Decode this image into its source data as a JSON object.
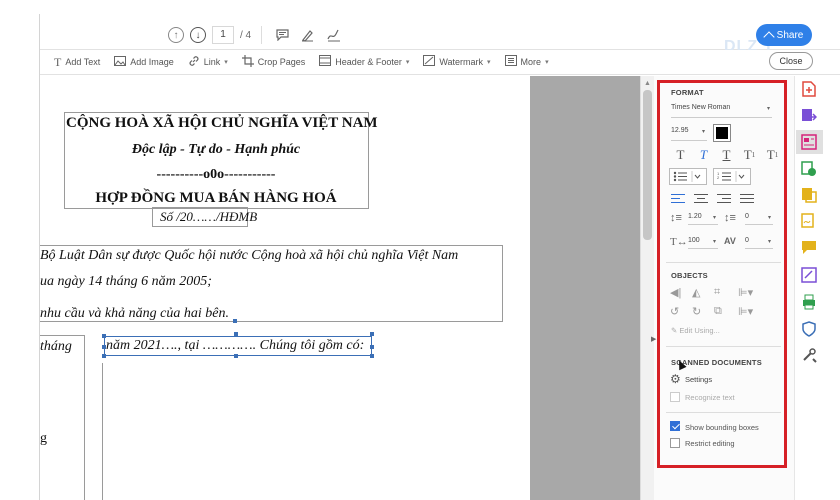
{
  "nav": {
    "page_current": "1",
    "page_total": "/ 4",
    "share_label": "Share"
  },
  "edit_toolbar": {
    "tools": [
      {
        "label": "Add Text",
        "icon": "text-icon"
      },
      {
        "label": "Add Image",
        "icon": "image-icon"
      },
      {
        "label": "Link",
        "icon": "link-icon",
        "dropdown": true
      },
      {
        "label": "Crop Pages",
        "icon": "crop-icon"
      },
      {
        "label": "Header & Footer",
        "icon": "header-footer-icon",
        "dropdown": true
      },
      {
        "label": "Watermark",
        "icon": "watermark-icon",
        "dropdown": true
      },
      {
        "label": "More",
        "icon": "more-icon",
        "dropdown": true
      }
    ],
    "close_label": "Close"
  },
  "watermark_logo": "DLZ T",
  "document": {
    "nation": "CỘNG HOÀ XÃ HỘI CHỦ NGHĨA VIỆT NAM",
    "motto": "Độc lập - Tự do - Hạnh phúc",
    "separator": "----------o0o-----------",
    "title": "HỢP ĐỒNG MUA BÁN HÀNG HOÁ",
    "number": "Số      /20……/HĐMB",
    "para_line1": "Bộ Luật Dân sự được Quốc hội nước Cộng hoà xã hội chủ nghĩa Việt Nam",
    "para_line2": "ua ngày 14 tháng 6 năm 2005;",
    "para_line3": "nhu cầu và khả năng của hai bên.",
    "cell_left": "tháng",
    "cell_year": "năm 2021…., tại …………. Chúng tôi gồm có:",
    "fragment_g": "g"
  },
  "format_panel": {
    "format_heading": "FORMAT",
    "font_family": "Times New Roman",
    "font_size": "12.95",
    "text_color": "#000000",
    "line_spacing": "1.20",
    "paragraph_spacing": "0",
    "horizontal_scale": "100",
    "char_spacing": "0",
    "objects_heading": "OBJECTS",
    "edit_using": "Edit Using...",
    "scanned_heading": "SCANNED DOCUMENTS",
    "settings_label": "Settings",
    "recognize_text": "Recognize text",
    "show_bounding_label": "Show bounding boxes",
    "show_bounding_checked": true,
    "restrict_editing_label": "Restrict editing",
    "restrict_editing_checked": false
  },
  "colors": {
    "accent": "#2f80e8",
    "highlight_outline": "#d62026",
    "rail_icons": [
      "#e04a3f",
      "#7a4fd6",
      "#d6237a",
      "#2f9f4e",
      "#e3b21b",
      "#e3b21b",
      "#2f9f4e",
      "#3b6fb6",
      "#555555"
    ]
  }
}
